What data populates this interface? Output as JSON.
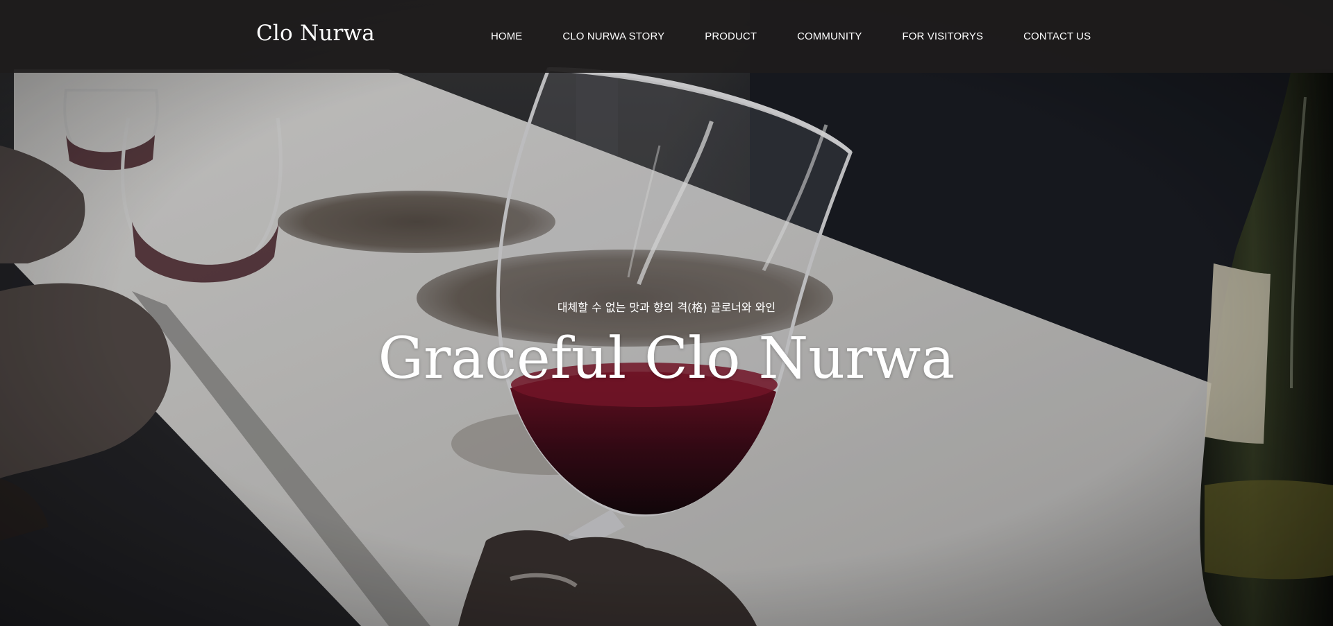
{
  "header": {
    "logo": "Clo Nurwa",
    "nav": [
      {
        "label": "HOME"
      },
      {
        "label": "CLO NURWA STORY"
      },
      {
        "label": "PRODUCT"
      },
      {
        "label": "COMMUNITY"
      },
      {
        "label": "FOR VISITORYS"
      },
      {
        "label": "CONTACT US"
      }
    ]
  },
  "hero": {
    "subtitle": "대체할 수 없는 맛과 향의 격(格) 끌로너와 와인",
    "title": "Graceful Clo Nurwa"
  },
  "colors": {
    "header_bg": "#1e1c1c",
    "text": "#ffffff",
    "wine": "#5a0f1e",
    "table": "#cfcfcf"
  }
}
